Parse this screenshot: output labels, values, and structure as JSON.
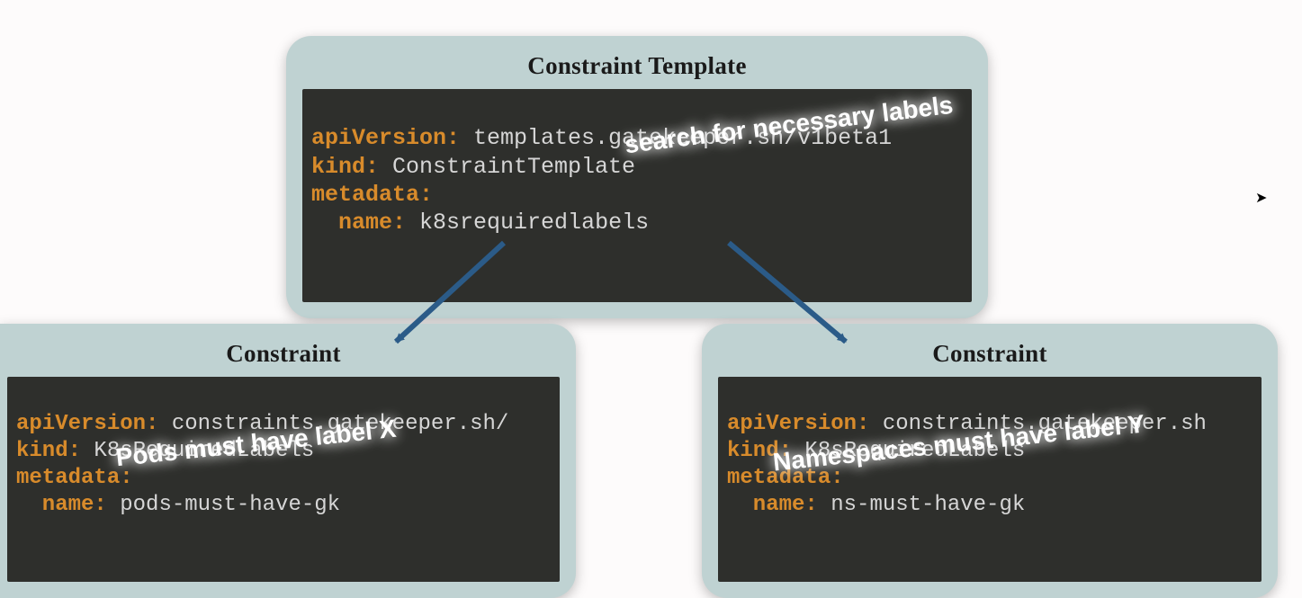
{
  "template": {
    "title": "Constraint Template",
    "yaml": {
      "apiVersionKey": "apiVersion:",
      "apiVersionVal": " templates.gatekeeper.sh/v1beta1",
      "kindKey": "kind:",
      "kindVal": " ConstraintTemplate",
      "metadataKey": "metadata:",
      "nameKey": "  name:",
      "nameVal": " k8srequiredlabels"
    },
    "overlay": "search for necessary labels"
  },
  "constraintLeft": {
    "title": "Constraint",
    "yaml": {
      "apiVersionKey": "apiVersion:",
      "apiVersionVal": " constraints.gatekeeper.sh/",
      "kindKey": "kind:",
      "kindVal": " K8sRequiredLabels",
      "metadataKey": "metadata:",
      "nameKey": "  name:",
      "nameVal": " pods-must-have-gk"
    },
    "overlay": "Pods must have label X"
  },
  "constraintRight": {
    "title": "Constraint",
    "yaml": {
      "apiVersionKey": "apiVersion:",
      "apiVersionVal": " constraints.gatekeeper.sh",
      "kindKey": "kind:",
      "kindVal": " K8sRequiredLabels",
      "metadataKey": "metadata:",
      "nameKey": "  name:",
      "nameVal": " ns-must-have-gk"
    },
    "overlay": "Namespaces must have label Y"
  },
  "colors": {
    "cardBg": "#bfd2d2",
    "codeBg": "#2e2f2c",
    "keyword": "#d88b2b",
    "value": "#d6d6d6",
    "arrow": "#2b5b88"
  }
}
